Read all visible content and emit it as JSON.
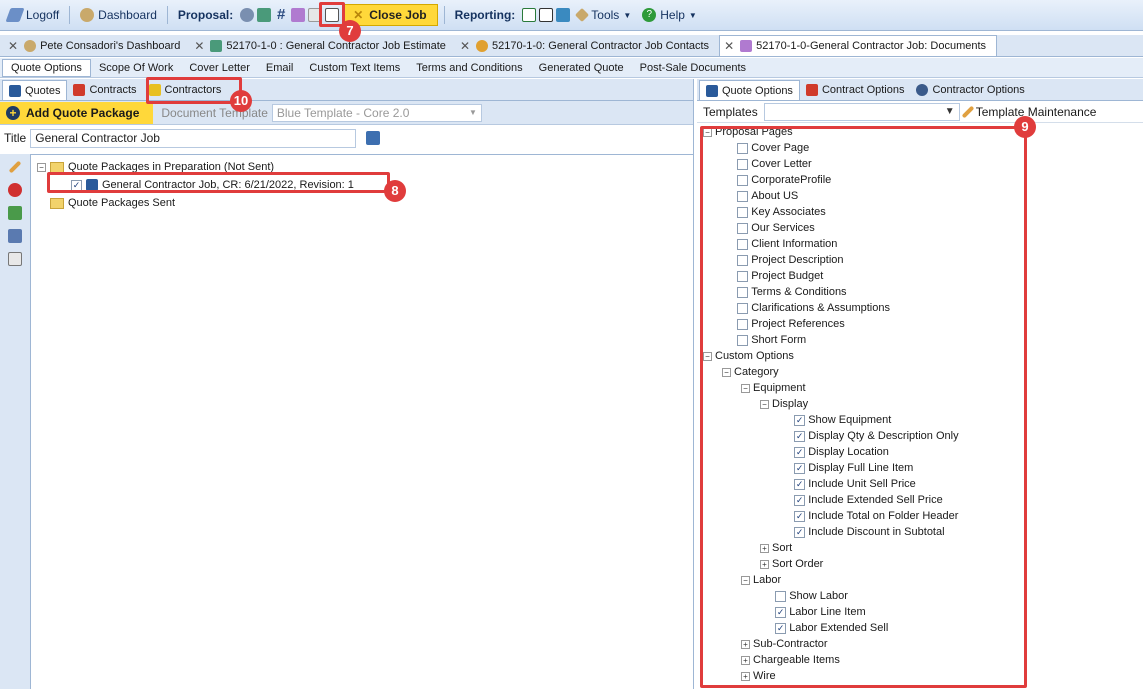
{
  "toolbar": {
    "logoff": "Logoff",
    "dashboard": "Dashboard",
    "proposal_label": "Proposal:",
    "close_job": "Close Job",
    "reporting_label": "Reporting:",
    "tools": "Tools",
    "help": "Help"
  },
  "doc_tabs": [
    {
      "label": "Pete Consadori's Dashboard"
    },
    {
      "label": "52170-1-0 : General Contractor Job Estimate"
    },
    {
      "label": "52170-1-0: General Contractor Job Contacts"
    },
    {
      "label": "52170-1-0-General Contractor Job: Documents"
    }
  ],
  "sub_tabs": [
    "Quote Options",
    "Scope Of Work",
    "Cover Letter",
    "Email",
    "Custom Text Items",
    "Terms and Conditions",
    "Generated Quote",
    "Post-Sale Documents"
  ],
  "left_tabs": {
    "quotes": "Quotes",
    "contracts": "Contracts",
    "contractors": "Contractors"
  },
  "quote_bar": {
    "add_package": "Add Quote Package",
    "document_template_label": "Document Template",
    "document_template_value": "Blue Template - Core 2.0"
  },
  "title_row": {
    "label": "Title",
    "value": "General Contractor Job"
  },
  "package_tree": {
    "in_prep": "Quote Packages in Preparation (Not Sent)",
    "item": "General Contractor Job, CR: 6/21/2022, Revision: 1",
    "sent": "Quote Packages Sent"
  },
  "right_tabs": {
    "quote_options": "Quote Options",
    "contract_options": "Contract Options",
    "contractor_options": "Contractor Options"
  },
  "templates": {
    "label": "Templates",
    "value": "",
    "maintenance": "Template Maintenance"
  },
  "options_tree": {
    "proposal_pages": "Proposal Pages",
    "pages": [
      "Cover Page",
      "Cover Letter",
      "CorporateProfile",
      "About US",
      "Key Associates",
      "Our Services",
      "Client Information",
      "Project Description",
      "Project Budget",
      "Terms & Conditions",
      "Clarifications & Assumptions",
      "Project References",
      "Short Form"
    ],
    "custom_options": "Custom Options",
    "category": "Category",
    "equipment": "Equipment",
    "display": "Display",
    "display_items": [
      "Show Equipment",
      "Display Qty & Description Only",
      "Display Location",
      "Display Full Line Item",
      "Include Unit Sell Price",
      "Include Extended Sell Price",
      "Include Total on Folder Header",
      "Include Discount in Subtotal"
    ],
    "sort": "Sort",
    "sort_order": "Sort Order",
    "labor": "Labor",
    "labor_items": [
      {
        "label": "Show Labor",
        "checked": false
      },
      {
        "label": "Labor Line Item",
        "checked": true
      },
      {
        "label": "Labor Extended Sell",
        "checked": true
      }
    ],
    "sub_contractor": "Sub-Contractor",
    "chargeable_items": "Chargeable Items",
    "wire": "Wire"
  },
  "callouts": {
    "c7": "7",
    "c8": "8",
    "c9": "9",
    "c10": "10"
  },
  "colors": {
    "accent": "#ffd83a",
    "callout": "#e03c3c",
    "chrome": "#dbe6f4"
  }
}
